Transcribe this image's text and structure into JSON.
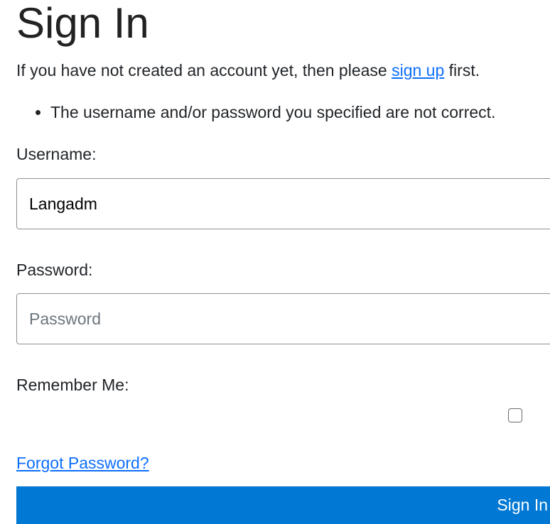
{
  "page": {
    "title": "Sign In",
    "intro_before": "If you have not created an account yet, then please ",
    "signup_link": "sign up",
    "intro_after": " first."
  },
  "errors": [
    "The username and/or password you specified are not correct."
  ],
  "form": {
    "username_label": "Username:",
    "username_value": "Langadm",
    "password_label": "Password:",
    "password_placeholder": "Password",
    "remember_label": "Remember Me:",
    "remember_checked": false,
    "forgot_link": "Forgot Password?",
    "submit_label": "Sign In"
  },
  "colors": {
    "link": "#0d6efd",
    "primary_button": "#0078d4"
  }
}
